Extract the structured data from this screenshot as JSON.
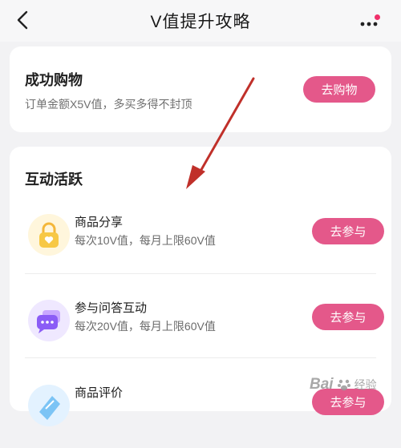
{
  "header": {
    "title": "V值提升攻略"
  },
  "shopping": {
    "title": "成功购物",
    "subtitle": "订单金额X5V值，多买多得不封顶",
    "button": "去购物"
  },
  "interaction": {
    "title": "互动活跃",
    "items": [
      {
        "name": "商品分享",
        "desc": "每次10V值，每月上限60V值",
        "button": "去参与",
        "icon": "lock-heart-icon"
      },
      {
        "name": "参与问答互动",
        "desc": "每次20V值，每月上限60V值",
        "button": "去参与",
        "icon": "chat-bubble-icon"
      },
      {
        "name": "商品评价",
        "desc": "",
        "button": "去参与",
        "icon": "review-icon"
      }
    ]
  },
  "watermark": {
    "brand": "Bai",
    "suffix": "经验"
  },
  "colors": {
    "accent": "#e4588a",
    "notification": "#f0306a",
    "annotation_arrow": "#c0302a"
  }
}
